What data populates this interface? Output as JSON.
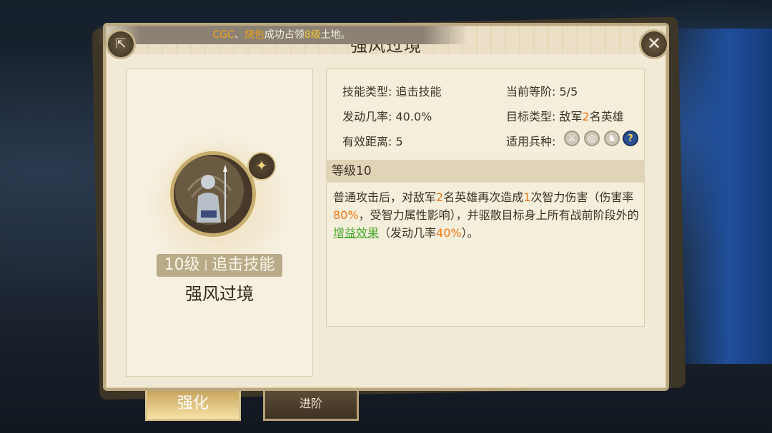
{
  "skill": {
    "title": "强风过境",
    "level_label": "10级",
    "separator": "|",
    "type_label": "追击技能",
    "name": "强风过境"
  },
  "broadcast": {
    "player1": "CGC",
    "sep": "、",
    "player2": "烧包",
    "mid": "成功占领",
    "level": "8级",
    "end": "土地。"
  },
  "attributes": {
    "skill_type_label": "技能类型:",
    "skill_type_value": "追击技能",
    "current_rank_label": "当前等阶:",
    "current_rank_value": "5/5",
    "trigger_rate_label": "发动几率:",
    "trigger_rate_value": "40.0%",
    "target_type_label": "目标类型:",
    "target_type_prefix": "敌军",
    "target_type_num": "2",
    "target_type_suffix": "名英雄",
    "range_label": "有效距离:",
    "range_value": "5",
    "unit_types_label": "适用兵种:",
    "unit_icons": [
      "sword-icon",
      "target-icon",
      "horse-icon",
      "question-icon"
    ]
  },
  "level_section": {
    "header": "等级10",
    "desc_parts": {
      "p1": "普通攻击后，对敌军",
      "n1": "2",
      "p2": "名英雄再次造成",
      "n2": "1",
      "p3": "次智力伤害（伤害率",
      "n3": "80%",
      "p4": "，受智力属性影响），并驱散目标身上所有战前阶段外的",
      "link": "增益效果",
      "p5": "（发动几率",
      "n4": "40%",
      "p6": "）。"
    }
  },
  "tabs": {
    "strengthen": "强化",
    "advance": "进阶"
  },
  "colors": {
    "accent_orange": "#f07a13",
    "link_green": "#4caa2f",
    "panel_bg": "#f1ead6"
  }
}
